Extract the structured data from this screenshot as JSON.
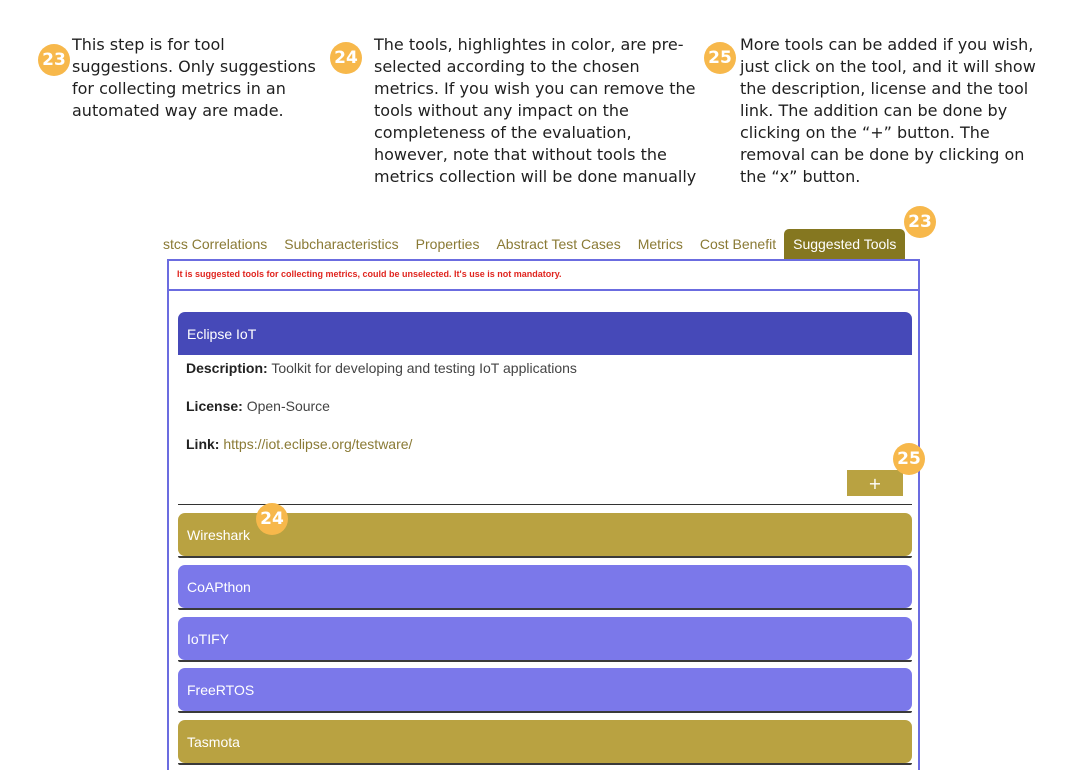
{
  "badges": {
    "n23": "23",
    "n24": "24",
    "n25": "25"
  },
  "notes": {
    "n23": "This step is for tool suggestions. Only suggestions for collecting metrics in an automated way are made.",
    "n24": "The tools, highlightes in color, are pre-selected according to the chosen metrics. If you wish you can remove the tools without any impact on the completeness of the evaluation, however, note that without tools the metrics collection will be done manually",
    "n25": "More tools can be added if you wish, just click on the tool, and it will show the description, license and the tool link. The addition can be done by clicking on the “+” button. The removal can be done by clicking on the “x” button."
  },
  "tabs": {
    "t0": "stcs Correlations",
    "t1": "Subcharacteristics",
    "t2": "Properties",
    "t3": "Abstract Test Cases",
    "t4": "Metrics",
    "t5": "Cost Benefit",
    "t6": "Suggested Tools"
  },
  "warning": "It is suggested tools for collecting metrics, could be unselected. It's use is not mandatory.",
  "expanded_tool": {
    "name": "Eclipse IoT",
    "description_label": "Description:",
    "description": "Toolkit for developing and testing IoT applications",
    "license_label": "License:",
    "license": "Open-Source",
    "link_label": "Link:",
    "link": "https://iot.eclipse.org/testware/",
    "add_label": "+"
  },
  "tools": {
    "wireshark": "Wireshark",
    "coapthon": "CoAPthon",
    "iotify": "IoTIFY",
    "freertos": "FreeRTOS",
    "tasmota": "Tasmota"
  },
  "colors": {
    "badge": "#f7b84b",
    "active_tab": "#857720",
    "selected_tool": "#b9a241",
    "unselected_tool": "#7b78ea",
    "expanded_tool": "#4649b8",
    "panel_border": "#6b6ce0",
    "warning": "#e0251f"
  }
}
